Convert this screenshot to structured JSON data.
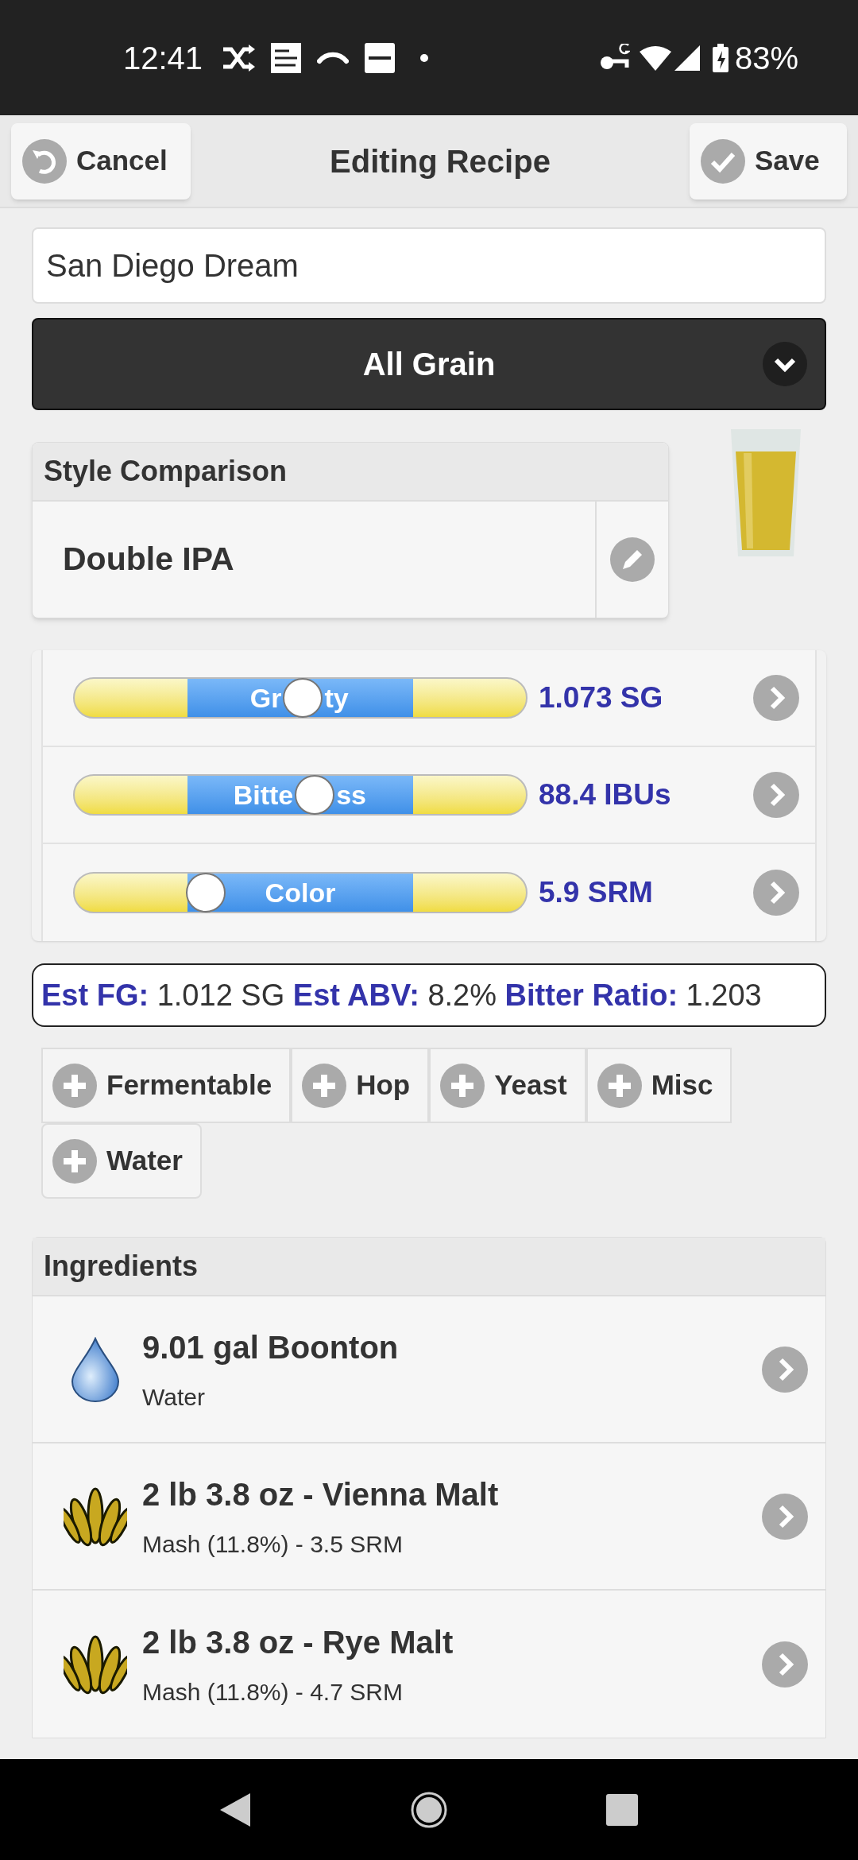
{
  "status_bar": {
    "time": "12:41",
    "battery": "83%"
  },
  "header": {
    "cancel": "Cancel",
    "title": "Editing Recipe",
    "save": "Save"
  },
  "recipe_name": {
    "value": "San Diego Dream"
  },
  "type_select": {
    "value": "All Grain"
  },
  "style_comparison": {
    "title": "Style Comparison",
    "style": "Double IPA"
  },
  "sliders": [
    {
      "label_parts": [
        "Gr",
        "ty"
      ],
      "level": 0.506,
      "reading": "1.073 SG"
    },
    {
      "label_parts": [
        "Bitte",
        "ss"
      ],
      "level": 0.532,
      "reading": "88.4 IBUs"
    },
    {
      "label_parts": [
        "Color"
      ],
      "level": 0.29,
      "reading": "5.9 SRM"
    }
  ],
  "estimates": "**Est FG:** 1.012 SG **Est ABV:** 8.2% **Bitter Ratio:** 1.203",
  "add_buttons": [
    "Fermentable",
    "Hop",
    "Yeast",
    "Misc",
    "Water"
  ],
  "ingredients": {
    "title": "Ingredients",
    "items": [
      {
        "kind": "water",
        "name": "9.01 gal Boonton",
        "detail": "Water"
      },
      {
        "kind": "grain",
        "name": "2 lb 3.8 oz - Vienna Malt",
        "detail": "Mash (11.8%) - 3.5 SRM"
      },
      {
        "kind": "grain",
        "name": "2 lb 3.8 oz - Rye Malt",
        "detail": "Mash (11.8%) - 4.7 SRM"
      }
    ]
  }
}
